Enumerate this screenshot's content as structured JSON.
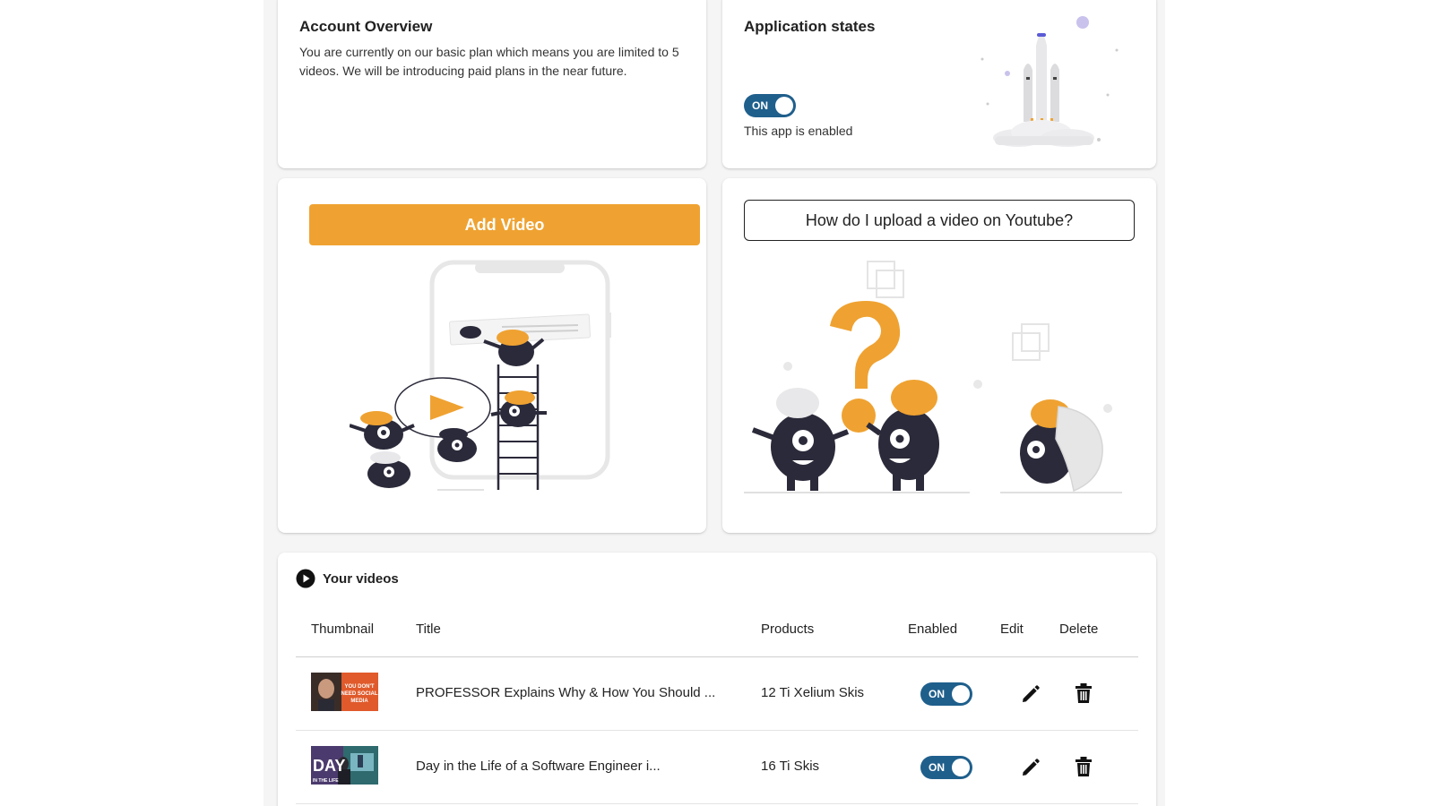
{
  "account": {
    "title": "Account Overview",
    "description": "You are currently on our basic plan which means you are limited to 5 videos. We will be introducing paid plans in the near future."
  },
  "app_state": {
    "title": "Application states",
    "toggle_label": "ON",
    "status_text": "This app is enabled"
  },
  "add_video": {
    "button_label": "Add Video"
  },
  "help": {
    "button_label": "How do I upload a video on Youtube?"
  },
  "videos": {
    "title": "Your videos",
    "columns": [
      "Thumbnail",
      "Title",
      "Products",
      "Enabled",
      "Edit",
      "Delete"
    ],
    "rows": [
      {
        "title": "PROFESSOR Explains Why & How You Should ...",
        "products": "12 Ti Xelium Skis",
        "enabled": "ON",
        "thumbnail_text": "YOU DON'T NEED SOCIAL MEDIA"
      },
      {
        "title": "Day in the Life of a Software Engineer i...",
        "products": "16 Ti Skis",
        "enabled": "ON",
        "thumbnail_text": "DAY"
      }
    ]
  },
  "colors": {
    "accent_orange": "#efa231",
    "toggle_blue": "#1f5f8c",
    "dark_figure": "#2b2a3a"
  }
}
